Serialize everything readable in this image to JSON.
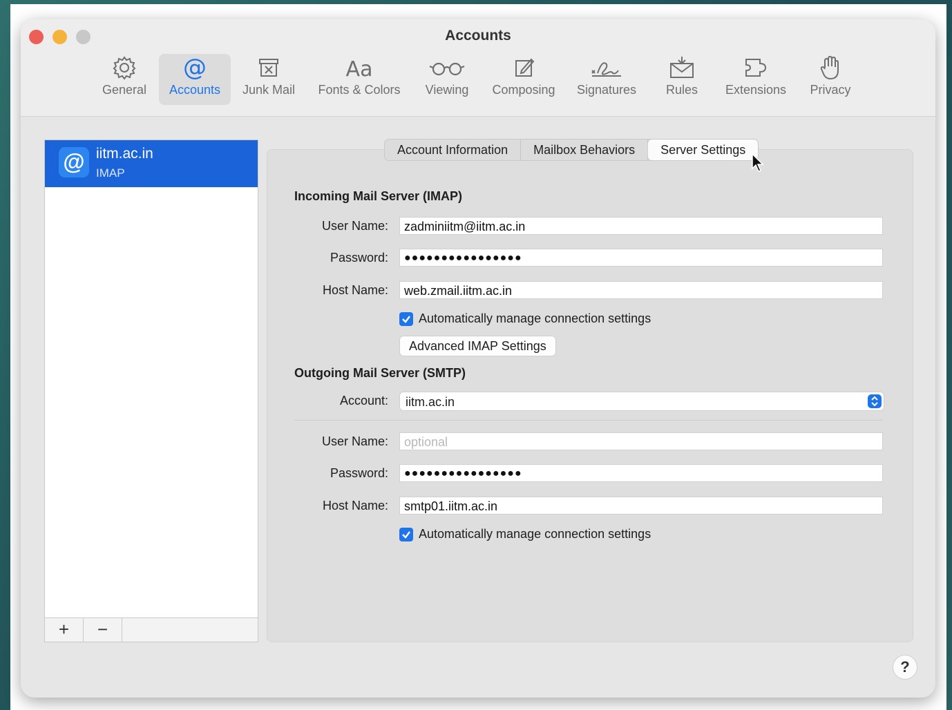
{
  "window": {
    "title": "Accounts"
  },
  "toolbar": {
    "items": [
      {
        "label": "General",
        "icon": "gear-icon"
      },
      {
        "label": "Accounts",
        "icon": "at-icon",
        "active": true
      },
      {
        "label": "Junk Mail",
        "icon": "junk-mail-icon"
      },
      {
        "label": "Fonts & Colors",
        "icon": "fonts-icon"
      },
      {
        "label": "Viewing",
        "icon": "glasses-icon"
      },
      {
        "label": "Composing",
        "icon": "compose-icon"
      },
      {
        "label": "Signatures",
        "icon": "signature-icon"
      },
      {
        "label": "Rules",
        "icon": "rules-icon"
      },
      {
        "label": "Extensions",
        "icon": "extensions-icon"
      },
      {
        "label": "Privacy",
        "icon": "hand-icon"
      }
    ]
  },
  "sidebar": {
    "accounts": [
      {
        "name": "iitm.ac.in",
        "type": "IMAP",
        "badge": "@"
      }
    ],
    "add_label": "+",
    "remove_label": "−"
  },
  "tabs": [
    {
      "label": "Account Information"
    },
    {
      "label": "Mailbox Behaviors"
    },
    {
      "label": "Server Settings",
      "active": true
    }
  ],
  "incoming": {
    "title": "Incoming Mail Server (IMAP)",
    "username_label": "User Name:",
    "username": "zadminiitm@iitm.ac.in",
    "password_label": "Password:",
    "password": "●●●●●●●●●●●●●●●●",
    "hostname_label": "Host Name:",
    "hostname": "web.zmail.iitm.ac.in",
    "auto_manage_label": "Automatically manage connection settings",
    "auto_manage_checked": true,
    "advanced_button": "Advanced IMAP Settings"
  },
  "outgoing": {
    "title": "Outgoing Mail Server (SMTP)",
    "account_label": "Account:",
    "account": "iitm.ac.in",
    "username_label": "User Name:",
    "username_placeholder": "optional",
    "password_label": "Password:",
    "password": "●●●●●●●●●●●●●●●●",
    "hostname_label": "Host Name:",
    "hostname": "smtp01.iitm.ac.in",
    "auto_manage_label": "Automatically manage connection settings",
    "auto_manage_checked": true
  },
  "help_label": "?",
  "colors": {
    "accent": "#1f75e8",
    "selection": "#1b63d9"
  }
}
